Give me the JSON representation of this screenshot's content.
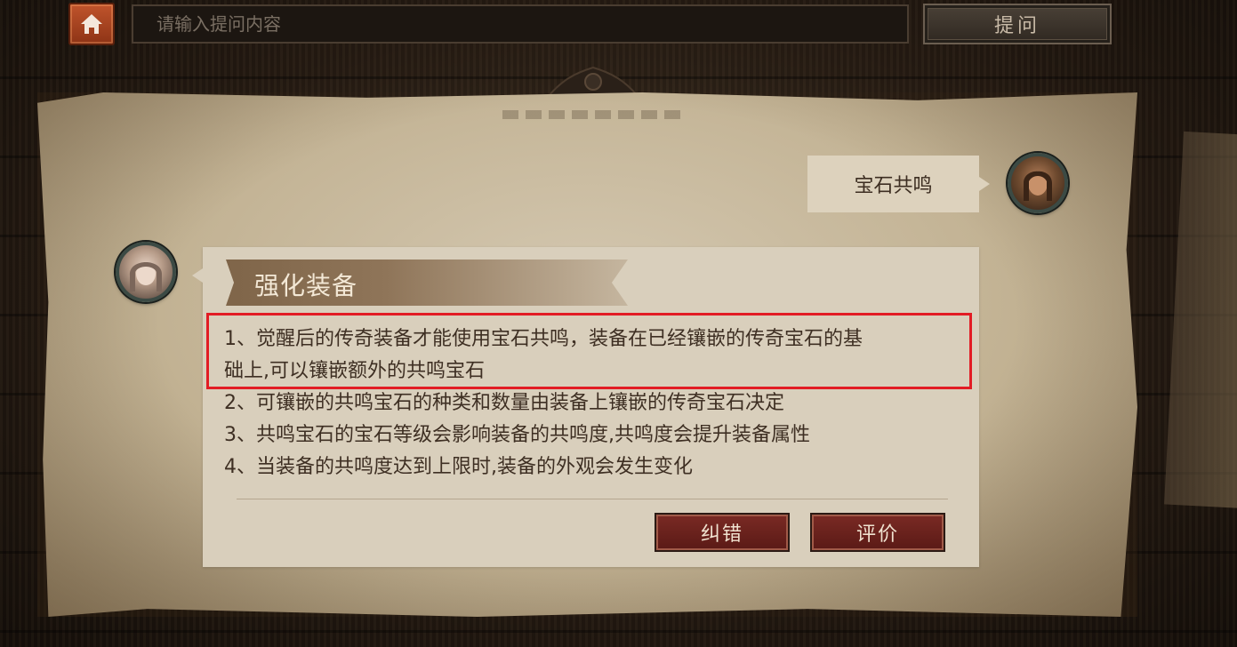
{
  "topbar": {
    "search_placeholder": "请输入提问内容",
    "ask_label": "提问"
  },
  "conversation": {
    "user_question": "宝石共鸣",
    "answer": {
      "title": "强化装备",
      "lines": [
        "1、觉醒后的传奇装备才能使用宝石共鸣，装备在已经镶嵌的传奇宝石的基",
        "础上,可以镶嵌额外的共鸣宝石",
        "2、可镶嵌的共鸣宝石的种类和数量由装备上镶嵌的传奇宝石决定",
        "3、共鸣宝石的宝石等级会影响装备的共鸣度,共鸣度会提升装备属性",
        "4、当装备的共鸣度达到上限时,装备的外观会发生变化"
      ],
      "buttons": {
        "correct_label": "纠错",
        "rate_label": "评价"
      }
    }
  },
  "colors": {
    "accent_red_button": "#7a2a24",
    "highlight_box": "#e21c24",
    "home_button": "#c0542c",
    "parchment": "#d4c8b1"
  },
  "icons": {
    "home": "home-icon",
    "user_avatar": "user-avatar-icon",
    "bot_avatar": "assistant-avatar-icon"
  }
}
